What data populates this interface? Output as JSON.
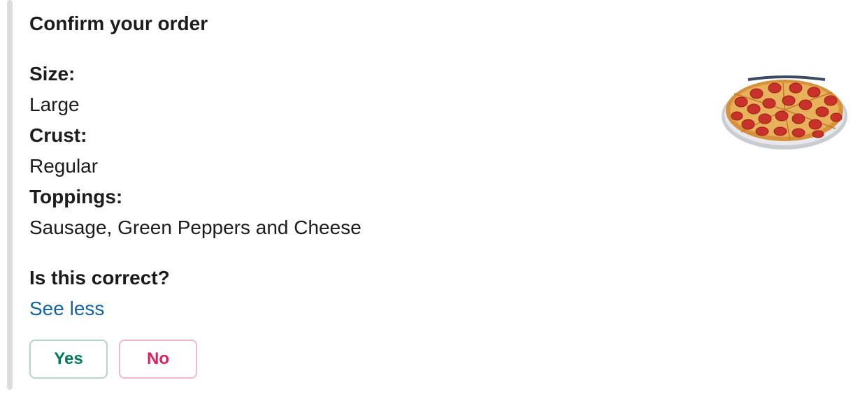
{
  "attachment": {
    "title": "Confirm your order",
    "fields": [
      {
        "label": "Size:",
        "value": "Large"
      },
      {
        "label": "Crust:",
        "value": "Regular"
      },
      {
        "label": "Toppings:",
        "value": "Sausage, Green Peppers and Cheese"
      }
    ],
    "question": "Is this correct?",
    "see_less_link": "See less",
    "buttons": {
      "yes_label": "Yes",
      "no_label": "No"
    },
    "image_icon": "pizza-image"
  },
  "colors": {
    "link": "#1264a3",
    "yes": "#007a5a",
    "no": "#e01e5a",
    "accent_bar": "#dddddd"
  }
}
